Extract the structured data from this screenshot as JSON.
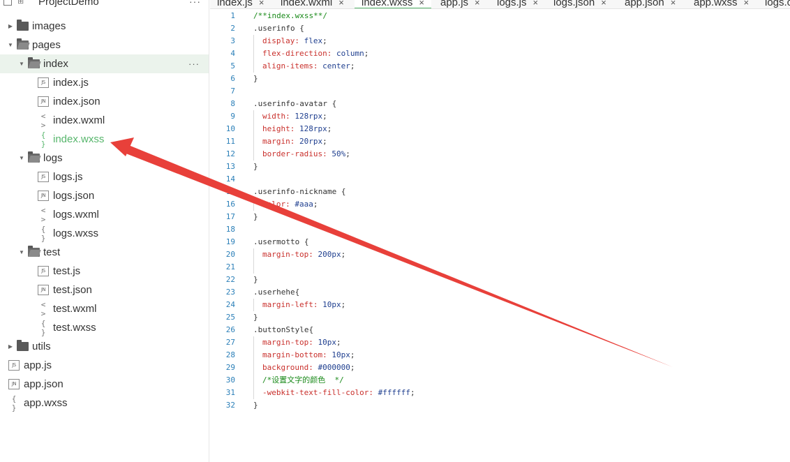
{
  "sidebar": {
    "project_title": "ProjectDemo",
    "more": "···",
    "tree": [
      {
        "label": "images",
        "kind": "folder",
        "depth": 0,
        "expanded": false
      },
      {
        "label": "pages",
        "kind": "folder",
        "depth": 0,
        "expanded": true
      },
      {
        "label": "index",
        "kind": "folder",
        "depth": 1,
        "expanded": true,
        "selected": true,
        "more": "···"
      },
      {
        "label": "index.js",
        "kind": "file",
        "badge": "JS",
        "depth": 2
      },
      {
        "label": "index.json",
        "kind": "file",
        "badge": "JN",
        "depth": 2
      },
      {
        "label": "index.wxml",
        "kind": "file",
        "glyph": "< >",
        "depth": 2
      },
      {
        "label": "index.wxss",
        "kind": "file",
        "glyph": "{ }",
        "depth": 2,
        "active": true
      },
      {
        "label": "logs",
        "kind": "folder",
        "depth": 1,
        "expanded": true
      },
      {
        "label": "logs.js",
        "kind": "file",
        "badge": "JS",
        "depth": 2
      },
      {
        "label": "logs.json",
        "kind": "file",
        "badge": "JN",
        "depth": 2
      },
      {
        "label": "logs.wxml",
        "kind": "file",
        "glyph": "< >",
        "depth": 2
      },
      {
        "label": "logs.wxss",
        "kind": "file",
        "glyph": "{ }",
        "depth": 2
      },
      {
        "label": "test",
        "kind": "folder",
        "depth": 1,
        "expanded": true
      },
      {
        "label": "test.js",
        "kind": "file",
        "badge": "JS",
        "depth": 2
      },
      {
        "label": "test.json",
        "kind": "file",
        "badge": "JN",
        "depth": 2
      },
      {
        "label": "test.wxml",
        "kind": "file",
        "glyph": "< >",
        "depth": 2
      },
      {
        "label": "test.wxss",
        "kind": "file",
        "glyph": "{ }",
        "depth": 2
      },
      {
        "label": "utils",
        "kind": "folder",
        "depth": 0,
        "expanded": false
      },
      {
        "label": "app.js",
        "kind": "file",
        "badge": "JS",
        "depth": 0
      },
      {
        "label": "app.json",
        "kind": "file",
        "badge": "JN",
        "depth": 0
      },
      {
        "label": "app.wxss",
        "kind": "file",
        "glyph": "{ }",
        "depth": 0
      }
    ]
  },
  "tabs": [
    {
      "label": "index.js",
      "close": "×",
      "active": false
    },
    {
      "label": "index.wxml",
      "close": "×",
      "active": false
    },
    {
      "label": "index.wxss",
      "close": "×",
      "active": true
    },
    {
      "label": "app.js",
      "close": "×",
      "active": false
    },
    {
      "label": "logs.js",
      "close": "×",
      "active": false
    },
    {
      "label": "logs.json",
      "close": "×",
      "active": false
    },
    {
      "label": "app.json",
      "close": "×",
      "active": false
    },
    {
      "label": "app.wxss",
      "close": "×",
      "active": false
    },
    {
      "label": "logs.c",
      "close": "",
      "active": false
    }
  ],
  "editor": {
    "lines": [
      {
        "n": "1",
        "parts": [
          {
            "t": "/**index.wxss**/",
            "c": "comment"
          }
        ]
      },
      {
        "n": "2",
        "parts": [
          {
            "t": ".userinfo {",
            "c": "sel"
          }
        ]
      },
      {
        "n": "3",
        "indent": true,
        "parts": [
          {
            "t": "display",
            "c": "prop"
          },
          {
            "t": ": ",
            "c": "prop"
          },
          {
            "t": "flex",
            "c": "val"
          },
          {
            "t": ";",
            "c": "text"
          }
        ]
      },
      {
        "n": "4",
        "indent": true,
        "parts": [
          {
            "t": "flex-direction",
            "c": "prop"
          },
          {
            "t": ": ",
            "c": "prop"
          },
          {
            "t": "column",
            "c": "val"
          },
          {
            "t": ";",
            "c": "text"
          }
        ]
      },
      {
        "n": "5",
        "indent": true,
        "parts": [
          {
            "t": "align-items",
            "c": "prop"
          },
          {
            "t": ": ",
            "c": "prop"
          },
          {
            "t": "center",
            "c": "val"
          },
          {
            "t": ";",
            "c": "text"
          }
        ]
      },
      {
        "n": "6",
        "parts": [
          {
            "t": "}",
            "c": "sel"
          }
        ]
      },
      {
        "n": "7",
        "parts": []
      },
      {
        "n": "8",
        "parts": [
          {
            "t": ".userinfo-avatar {",
            "c": "sel"
          }
        ]
      },
      {
        "n": "9",
        "indent": true,
        "parts": [
          {
            "t": "width",
            "c": "prop"
          },
          {
            "t": ": ",
            "c": "prop"
          },
          {
            "t": "128rpx",
            "c": "val"
          },
          {
            "t": ";",
            "c": "text"
          }
        ]
      },
      {
        "n": "10",
        "indent": true,
        "parts": [
          {
            "t": "height",
            "c": "prop"
          },
          {
            "t": ": ",
            "c": "prop"
          },
          {
            "t": "128rpx",
            "c": "val"
          },
          {
            "t": ";",
            "c": "text"
          }
        ]
      },
      {
        "n": "11",
        "indent": true,
        "parts": [
          {
            "t": "margin",
            "c": "prop"
          },
          {
            "t": ": ",
            "c": "prop"
          },
          {
            "t": "20rpx",
            "c": "val"
          },
          {
            "t": ";",
            "c": "text"
          }
        ]
      },
      {
        "n": "12",
        "indent": true,
        "parts": [
          {
            "t": "border-radius",
            "c": "prop"
          },
          {
            "t": ": ",
            "c": "prop"
          },
          {
            "t": "50%",
            "c": "val"
          },
          {
            "t": ";",
            "c": "text"
          }
        ]
      },
      {
        "n": "13",
        "parts": [
          {
            "t": "}",
            "c": "sel"
          }
        ]
      },
      {
        "n": "14",
        "parts": []
      },
      {
        "n": "15",
        "parts": [
          {
            "t": ".userinfo-nickname {",
            "c": "sel"
          }
        ]
      },
      {
        "n": "16",
        "indent": true,
        "parts": [
          {
            "t": "color",
            "c": "prop"
          },
          {
            "t": ": ",
            "c": "prop"
          },
          {
            "t": "#aaa",
            "c": "val"
          },
          {
            "t": ";",
            "c": "text"
          }
        ]
      },
      {
        "n": "17",
        "parts": [
          {
            "t": "}",
            "c": "sel"
          }
        ]
      },
      {
        "n": "18",
        "parts": []
      },
      {
        "n": "19",
        "parts": [
          {
            "t": ".usermotto {",
            "c": "sel"
          }
        ]
      },
      {
        "n": "20",
        "indent": true,
        "parts": [
          {
            "t": "margin-top",
            "c": "prop"
          },
          {
            "t": ": ",
            "c": "prop"
          },
          {
            "t": "200px",
            "c": "val"
          },
          {
            "t": ";",
            "c": "text"
          }
        ]
      },
      {
        "n": "21",
        "indent": true,
        "parts": []
      },
      {
        "n": "22",
        "parts": [
          {
            "t": "}",
            "c": "sel"
          }
        ]
      },
      {
        "n": "23",
        "parts": [
          {
            "t": ".userhehe{",
            "c": "sel"
          }
        ]
      },
      {
        "n": "24",
        "indent": true,
        "parts": [
          {
            "t": "margin-left",
            "c": "prop"
          },
          {
            "t": ": ",
            "c": "prop"
          },
          {
            "t": "10px",
            "c": "val"
          },
          {
            "t": ";",
            "c": "text"
          }
        ]
      },
      {
        "n": "25",
        "parts": [
          {
            "t": "}",
            "c": "sel"
          }
        ]
      },
      {
        "n": "26",
        "parts": [
          {
            "t": ".buttonStyle{",
            "c": "sel"
          }
        ]
      },
      {
        "n": "27",
        "indent": true,
        "parts": [
          {
            "t": "margin-top",
            "c": "prop"
          },
          {
            "t": ": ",
            "c": "prop"
          },
          {
            "t": "10px",
            "c": "val"
          },
          {
            "t": ";",
            "c": "text"
          }
        ]
      },
      {
        "n": "28",
        "indent": true,
        "parts": [
          {
            "t": "margin-bottom",
            "c": "prop"
          },
          {
            "t": ": ",
            "c": "prop"
          },
          {
            "t": "10px",
            "c": "val"
          },
          {
            "t": ";",
            "c": "text"
          }
        ]
      },
      {
        "n": "29",
        "indent": true,
        "parts": [
          {
            "t": "background",
            "c": "prop"
          },
          {
            "t": ": ",
            "c": "prop"
          },
          {
            "t": "#000000",
            "c": "val"
          },
          {
            "t": ";",
            "c": "text"
          }
        ]
      },
      {
        "n": "30",
        "indent": true,
        "parts": [
          {
            "t": "/*设置文字的颜色  */",
            "c": "comment"
          }
        ]
      },
      {
        "n": "31",
        "indent": true,
        "parts": [
          {
            "t": "-webkit-text-fill-color",
            "c": "prop"
          },
          {
            "t": ": ",
            "c": "prop"
          },
          {
            "t": "#ffffff",
            "c": "val"
          },
          {
            "t": ";",
            "c": "text"
          }
        ]
      },
      {
        "n": "32",
        "parts": [
          {
            "t": "}",
            "c": "sel"
          }
        ]
      }
    ]
  },
  "colors": {
    "accent_green": "#57b66c",
    "arrow_red": "#e8403a",
    "selected_row": "#ebf3ec",
    "line_number": "#2b7fb8"
  },
  "annotation": {
    "icon": "red-arrow-pointer",
    "points_to": "index.wxss"
  }
}
